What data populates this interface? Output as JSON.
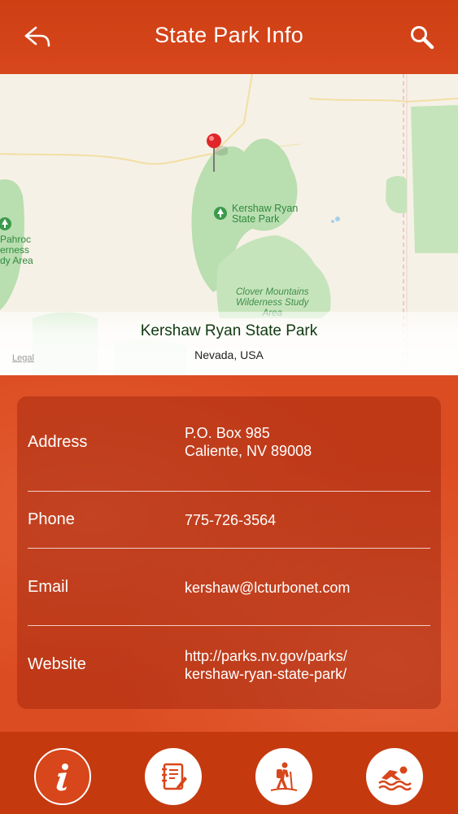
{
  "header": {
    "title": "State Park Info",
    "back_icon": "back-arrow-icon",
    "search_icon": "search-icon"
  },
  "map": {
    "labels": {
      "park": "Kershaw Ryan\nState Park",
      "wilderness": "Clover Mountains\nWilderness Study\nArea",
      "left_park": "Pahroc\nerness\ndy Area"
    },
    "legal": "Legal",
    "caption_name": "Kershaw Ryan State Park",
    "caption_region": "Nevada, USA"
  },
  "info": {
    "address_label": "Address",
    "address_line1": "P.O. Box 985",
    "address_line2": "Caliente, NV 89008",
    "phone_label": "Phone",
    "phone_value": "775-726-3564",
    "email_label": "Email",
    "email_value": "kershaw@lcturbonet.com",
    "website_label": "Website",
    "website_line1": "http://parks.nv.gov/parks/",
    "website_line2": "kershaw-ryan-state-park/"
  },
  "tabs": [
    {
      "icon": "info-icon",
      "active": true
    },
    {
      "icon": "notebook-icon",
      "active": false
    },
    {
      "icon": "hiker-icon",
      "active": false
    },
    {
      "icon": "swimmer-icon",
      "active": false
    }
  ],
  "colors": {
    "header": "#cf3f14",
    "background": "#dc4c22",
    "tabbar": "#c5390f",
    "park_green": "#b9deb0"
  }
}
